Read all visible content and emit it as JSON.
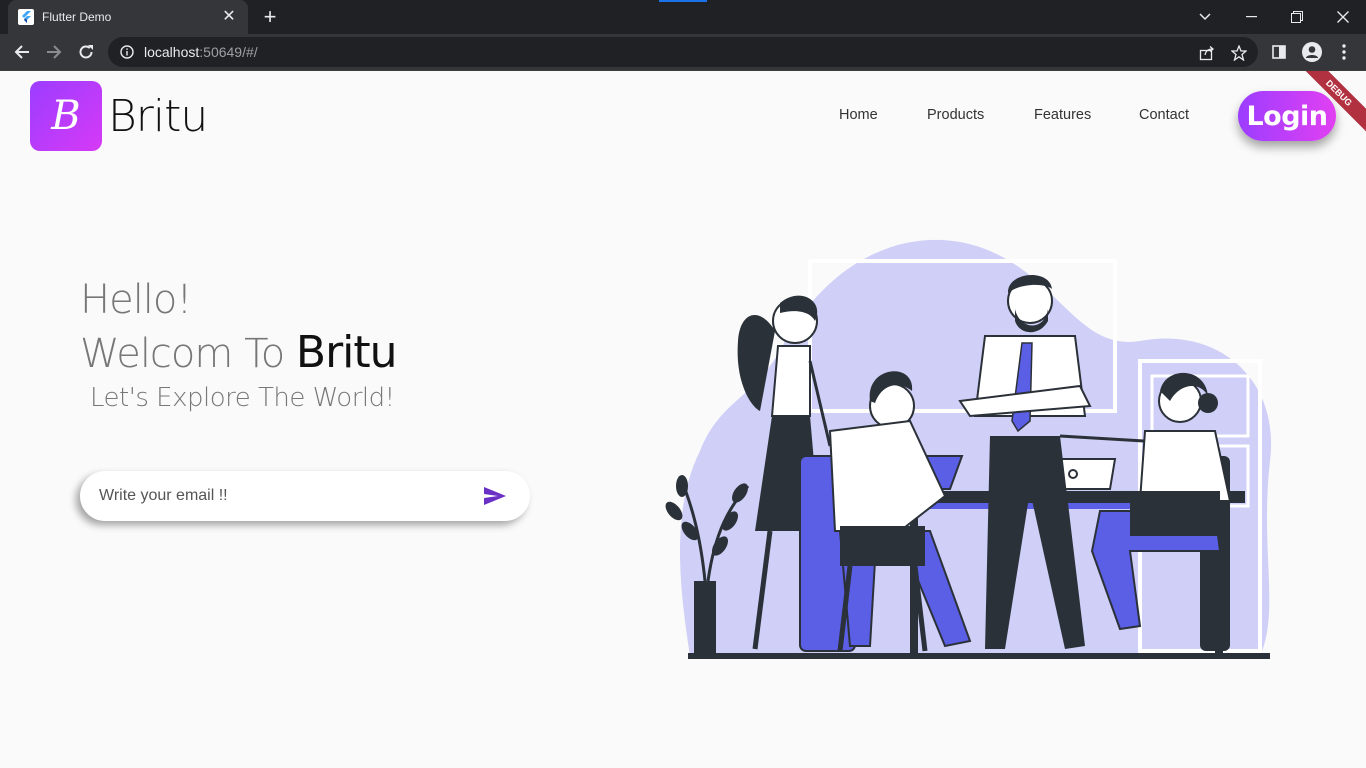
{
  "browser": {
    "tab_title": "Flutter Demo",
    "url_host": "localhost",
    "url_rest": ":50649/#/"
  },
  "page": {
    "brand": "Britu",
    "logo_letter": "B",
    "nav": [
      "Home",
      "Products",
      "Features",
      "Contact"
    ],
    "login_label": "Login",
    "debug_label": "DEBUG",
    "hero": {
      "hello": "Hello!",
      "welcome_prefix": "Welcom To ",
      "welcome_brand": "Britu",
      "subtitle": "Let's Explore The World!"
    },
    "email": {
      "placeholder": "Write your email !!",
      "value": ""
    }
  },
  "colors": {
    "brand_gradient_start": "#9c3dff",
    "brand_gradient_end": "#e140f2",
    "illustration_accent": "#5b5fe6",
    "illustration_blob": "#cfcff7",
    "debug_ribbon": "#b13140"
  },
  "icons": {
    "back": "arrow-left-icon",
    "forward": "arrow-right-icon",
    "reload": "reload-icon",
    "info": "info-icon",
    "share": "share-icon",
    "bookmark": "star-icon",
    "sidepanel": "side-panel-icon",
    "profile": "profile-icon",
    "menu": "kebab-menu-icon",
    "send": "send-icon"
  }
}
